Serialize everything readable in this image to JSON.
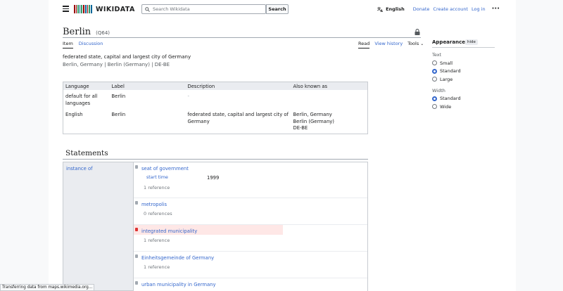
{
  "header": {
    "logo_text": "WIKIDATA",
    "search_placeholder": "Search Wikidata",
    "search_button": "Search",
    "language": "English",
    "links": [
      "Donate",
      "Create account",
      "Log in"
    ]
  },
  "item": {
    "title": "Berlin",
    "qid": "(Q64)",
    "tabs_left": [
      "Item",
      "Discussion"
    ],
    "tabs_right": [
      "Read",
      "View history",
      "Tools"
    ],
    "description": "federated state, capital and largest city of Germany",
    "aliases_line": "Berlin, Germany | Berlin (Germany) | DE-BE"
  },
  "terms": {
    "headers": [
      "Language",
      "Label",
      "Description",
      "Also known as"
    ],
    "rows": [
      {
        "language": "default for all languages",
        "label": "Berlin",
        "description": "-",
        "aliases": []
      },
      {
        "language": "English",
        "label": "Berlin",
        "description": "federated state, capital and largest city of Germany",
        "aliases": [
          "Berlin, Germany",
          "Berlin (Germany)",
          "DE-BE"
        ]
      }
    ]
  },
  "statements": {
    "heading": "Statements",
    "property": "instance of",
    "values": [
      {
        "value": "seat of government",
        "qualifier_prop": "start time",
        "qualifier_value": "1999",
        "references": "1 reference",
        "rank": "normal"
      },
      {
        "value": "metropolis",
        "references": "0 references",
        "rank": "normal"
      },
      {
        "value": "integrated municipality",
        "references": "1 reference",
        "rank": "deprecated"
      },
      {
        "value": "Einheitsgemeinde of Germany",
        "references": "1 reference",
        "rank": "normal"
      },
      {
        "value": "urban municipality in Germany",
        "rank": "normal"
      }
    ]
  },
  "appearance": {
    "title": "Appearance",
    "hide": "hide",
    "text_label": "Text",
    "text_options": [
      "Small",
      "Standard",
      "Large"
    ],
    "text_selected": "Standard",
    "width_label": "Width",
    "width_options": [
      "Standard",
      "Wide"
    ],
    "width_selected": "Standard"
  },
  "status_bar": "Transferring data from maps.wikimedia.org...",
  "colors": {
    "link": "#3366cc",
    "deprecated_bg": "#fee7e6",
    "logo": [
      "#990000",
      "#339966",
      "#006699"
    ]
  }
}
